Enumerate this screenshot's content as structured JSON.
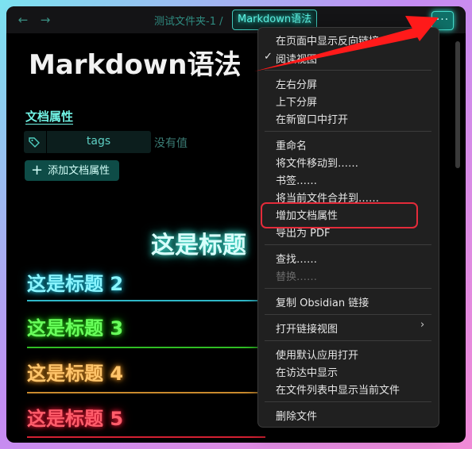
{
  "breadcrumb": {
    "parent": "测试文件夹-1",
    "separator": "/",
    "current": "Markdown语法"
  },
  "nav": {
    "back": "←",
    "forward": "→"
  },
  "more_button": "···",
  "page_title": "Markdown语法",
  "properties": {
    "heading": "文档属性",
    "tag_key": "tags",
    "tag_value": "没有值",
    "add_label": "添加文档属性",
    "add_icon": "+"
  },
  "headings": {
    "h1": "这是标题",
    "h2": "这是标题 2",
    "h3": "这是标题 3",
    "h4": "这是标题 4",
    "h5": "这是标题 5"
  },
  "menu": {
    "check_mark": "✓",
    "group1": [
      "在页面中显示反向链接",
      "阅读视图"
    ],
    "group2": [
      "左右分屏",
      "上下分屏",
      "在新窗口中打开"
    ],
    "group3": [
      "重命名",
      "将文件移动到……",
      "书签……",
      "将当前文件合并到……",
      "增加文档属性",
      "导出为 PDF"
    ],
    "group4": [
      "查找……",
      "替换……"
    ],
    "group5": [
      "复制 Obsidian 链接"
    ],
    "group6": [
      "打开链接视图"
    ],
    "submenu_arrow": "›",
    "group7": [
      "使用默认应用打开",
      "在访达中显示",
      "在文件列表中显示当前文件"
    ],
    "group8": [
      "删除文件"
    ]
  },
  "colors": {
    "accent": "#44d9c9",
    "highlight_box": "#e42b3a",
    "annotation_arrow": "#ff1a1a",
    "h2": "#8af5ff",
    "h3": "#69ff5c",
    "h4": "#ffc56b",
    "h5": "#ff5d6b"
  }
}
